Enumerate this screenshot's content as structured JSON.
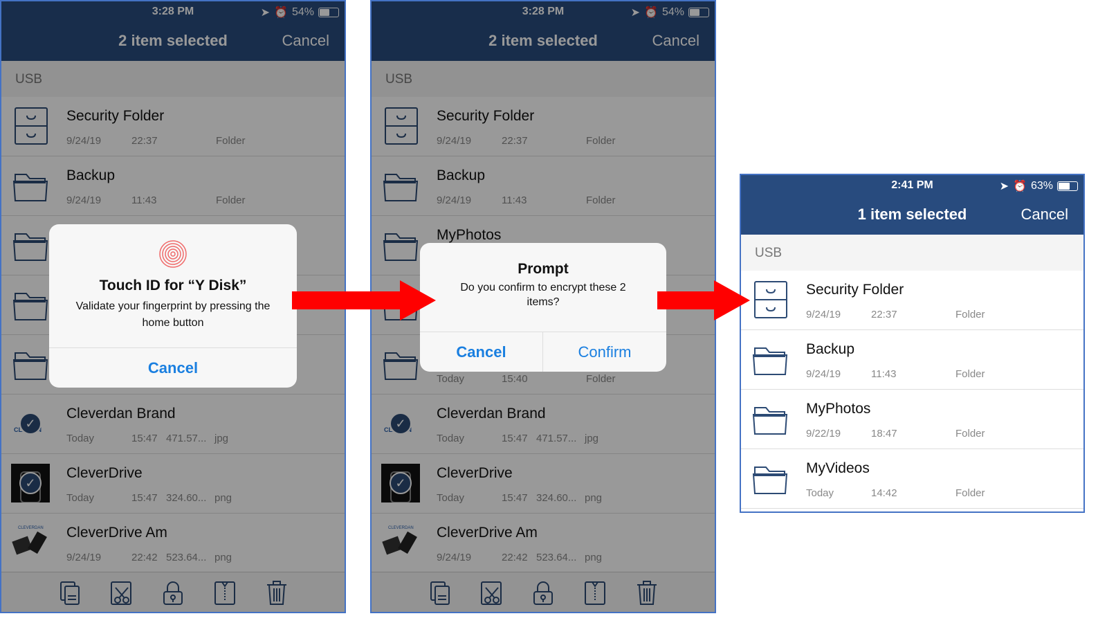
{
  "colors": {
    "header": "#284b7e",
    "accent": "#1a7fe0",
    "arrow": "#ff0000"
  },
  "screens": [
    {
      "status": {
        "time": "3:28 PM",
        "battery": "54%"
      },
      "title": "2 item selected",
      "cancel": "Cancel",
      "section": "USB",
      "rows": [
        {
          "icon": "cabinet",
          "name": "Security Folder",
          "date": "9/24/19",
          "time": "22:37",
          "size": "",
          "type": "Folder"
        },
        {
          "icon": "folder",
          "name": "Backup",
          "date": "9/24/19",
          "time": "11:43",
          "size": "",
          "type": "Folder"
        },
        {
          "icon": "folder",
          "name": "",
          "date": "",
          "time": "",
          "size": "",
          "type": ""
        },
        {
          "icon": "folder",
          "name": "",
          "date": "",
          "time": "",
          "size": "",
          "type": ""
        },
        {
          "icon": "folder",
          "name": "",
          "date": "",
          "time": "",
          "size": "",
          "type": ""
        },
        {
          "icon": "brand-thumb",
          "name": "Cleverdan Brand",
          "date": "Today",
          "time": "15:47",
          "size": "471.57...",
          "type": "jpg",
          "checked": true
        },
        {
          "icon": "drive-thumb",
          "name": "CleverDrive",
          "date": "Today",
          "time": "15:47",
          "size": "324.60...",
          "type": "png",
          "checked": true
        },
        {
          "icon": "product-thumb",
          "name": "CleverDrive Am",
          "date": "9/24/19",
          "time": "22:42",
          "size": "523.64...",
          "type": "png"
        }
      ],
      "toolbar": [
        "copy-icon",
        "cut-icon",
        "lock-icon",
        "zip-icon",
        "trash-icon"
      ],
      "dialog": {
        "icon": "fingerprint-icon",
        "title": "Touch ID for “Y Disk”",
        "message": "Validate your fingerprint by pressing the home button",
        "cancel": "Cancel"
      }
    },
    {
      "status": {
        "time": "3:28 PM",
        "battery": "54%"
      },
      "title": "2 item selected",
      "cancel": "Cancel",
      "section": "USB",
      "rows": [
        {
          "icon": "cabinet",
          "name": "Security Folder",
          "date": "9/24/19",
          "time": "22:37",
          "size": "",
          "type": "Folder"
        },
        {
          "icon": "folder",
          "name": "Backup",
          "date": "9/24/19",
          "time": "11:43",
          "size": "",
          "type": "Folder"
        },
        {
          "icon": "folder",
          "name": "MyPhotos",
          "date": "",
          "time": "",
          "size": "",
          "type": ""
        },
        {
          "icon": "folder",
          "name": "",
          "date": "",
          "time": "",
          "size": "",
          "type": ""
        },
        {
          "icon": "folder",
          "name": "",
          "date": "Today",
          "time": "15:40",
          "size": "",
          "type": "Folder"
        },
        {
          "icon": "brand-thumb",
          "name": "Cleverdan Brand",
          "date": "Today",
          "time": "15:47",
          "size": "471.57...",
          "type": "jpg",
          "checked": true
        },
        {
          "icon": "drive-thumb",
          "name": "CleverDrive",
          "date": "Today",
          "time": "15:47",
          "size": "324.60...",
          "type": "png",
          "checked": true
        },
        {
          "icon": "product-thumb",
          "name": "CleverDrive Am",
          "date": "9/24/19",
          "time": "22:42",
          "size": "523.64...",
          "type": "png"
        }
      ],
      "toolbar": [
        "copy-icon",
        "cut-icon",
        "lock-icon",
        "zip-icon",
        "trash-icon"
      ],
      "dialog": {
        "title": "Prompt",
        "message": "Do you confirm to encrypt these 2 items?",
        "cancel": "Cancel",
        "confirm": "Confirm"
      }
    },
    {
      "status": {
        "time": "2:41 PM",
        "battery": "63%"
      },
      "title": "1 item selected",
      "cancel": "Cancel",
      "section": "USB",
      "rows": [
        {
          "icon": "cabinet",
          "name": "Security Folder",
          "date": "9/24/19",
          "time": "22:37",
          "size": "",
          "type": "Folder"
        },
        {
          "icon": "folder",
          "name": "Backup",
          "date": "9/24/19",
          "time": "11:43",
          "size": "",
          "type": "Folder"
        },
        {
          "icon": "folder",
          "name": "MyPhotos",
          "date": "9/22/19",
          "time": "18:47",
          "size": "",
          "type": "Folder"
        },
        {
          "icon": "folder",
          "name": "MyVideos",
          "date": "Today",
          "time": "14:42",
          "size": "",
          "type": "Folder"
        }
      ]
    }
  ]
}
